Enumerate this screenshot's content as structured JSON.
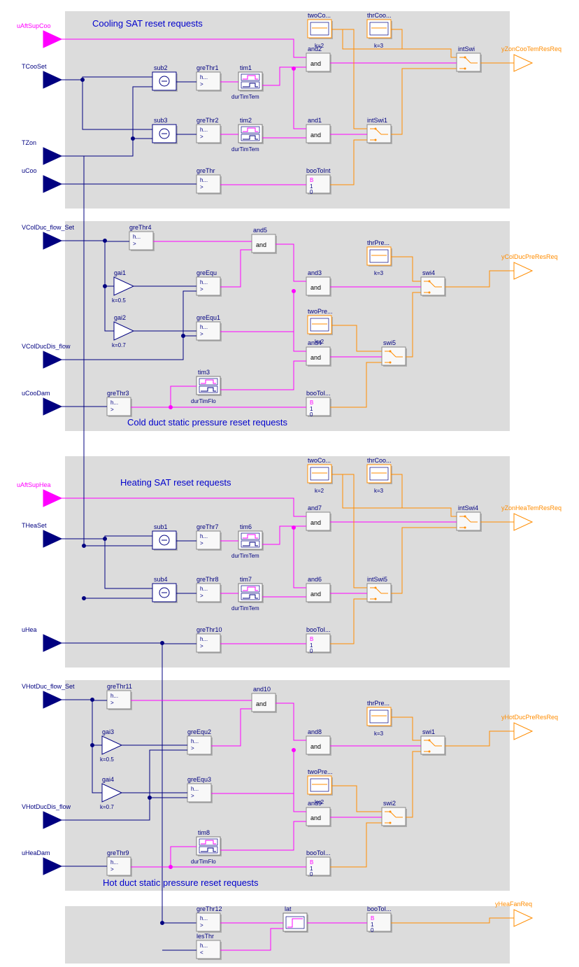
{
  "sections": {
    "cooling_sat": "Cooling SAT reset requests",
    "cold_duct": "Cold duct static pressure reset requests",
    "heating_sat": "Heating SAT reset requests",
    "hot_duct": "Hot duct static pressure reset requests"
  },
  "inputs": {
    "uAftSupCoo": "uAftSupCoo",
    "TCooSet": "TCooSet",
    "TZon": "TZon",
    "uCoo": "uCoo",
    "VColDuc_flow_Set": "VColDuc_flow_Set",
    "VColDucDis_flow": "VColDucDis_flow",
    "uCooDam": "uCooDam",
    "uAftSupHea": "uAftSupHea",
    "THeaSet": "THeaSet",
    "uHea": "uHea",
    "VHotDuc_flow_Set": "VHotDuc_flow_Set",
    "VHotDucDis_flow": "VHotDucDis_flow",
    "uHeaDam": "uHeaDam"
  },
  "outputs": {
    "yZonCooTemResReq": "yZonCooTemResReq",
    "yColDucPreResReq": "yColDucPreResReq",
    "yZonHeaTemResReq": "yZonHeaTemResReq",
    "yHotDucPreResReq": "yHotDucPreResReq",
    "yHeaFanReq": "yHeaFanReq"
  },
  "blocks": {
    "sub2": "sub2",
    "sub3": "sub3",
    "sub1": "sub1",
    "sub4": "sub4",
    "greThr1": "greThr1",
    "greThr2": "greThr2",
    "greThr": "greThr",
    "greThr4": "greThr4",
    "greThr3": "greThr3",
    "greThr7": "greThr7",
    "greThr8": "greThr8",
    "greThr10": "greThr10",
    "greThr11": "greThr11",
    "greThr9": "greThr9",
    "greThr12": "greThr12",
    "greEqu": "greEqu",
    "greEqu1": "greEqu1",
    "greEqu2": "greEqu2",
    "greEqu3": "greEqu3",
    "lesThr": "lesThr",
    "tim1": "tim1",
    "tim2": "tim2",
    "tim3": "tim3",
    "tim6": "tim6",
    "tim7": "tim7",
    "tim8": "tim8",
    "durTimTem": "durTimTem",
    "durTimFlo": "durTimFlo",
    "and1": "and1",
    "and2": "and2",
    "and3": "and3",
    "and4": "and4",
    "and5": "and5",
    "and6": "and6",
    "and7": "and7",
    "and8": "and8",
    "and9": "and9",
    "and10": "and10",
    "and": "and",
    "intSwi": "intSwi",
    "intSwi1": "intSwi1",
    "intSwi4": "intSwi4",
    "intSwi5": "intSwi5",
    "swi1": "swi1",
    "swi2": "swi2",
    "swi4": "swi4",
    "swi5": "swi5",
    "booToInt": "booToInt",
    "booToI": "booToI...",
    "twoCo": "twoCo...",
    "thrCoo": "thrCoo...",
    "twoPre": "twoPre...",
    "thrPre": "thrPre...",
    "gai1": "gai1",
    "gai2": "gai2",
    "gai3": "gai3",
    "gai4": "gai4",
    "lat": "lat",
    "h": "h...",
    "gt": ">",
    "lt": "<",
    "B": "B",
    "b1": "1",
    "b0": "0"
  },
  "k": {
    "k2": "k=2",
    "k3": "k=3",
    "k05": "k=0.5",
    "k07": "k=0.7"
  }
}
